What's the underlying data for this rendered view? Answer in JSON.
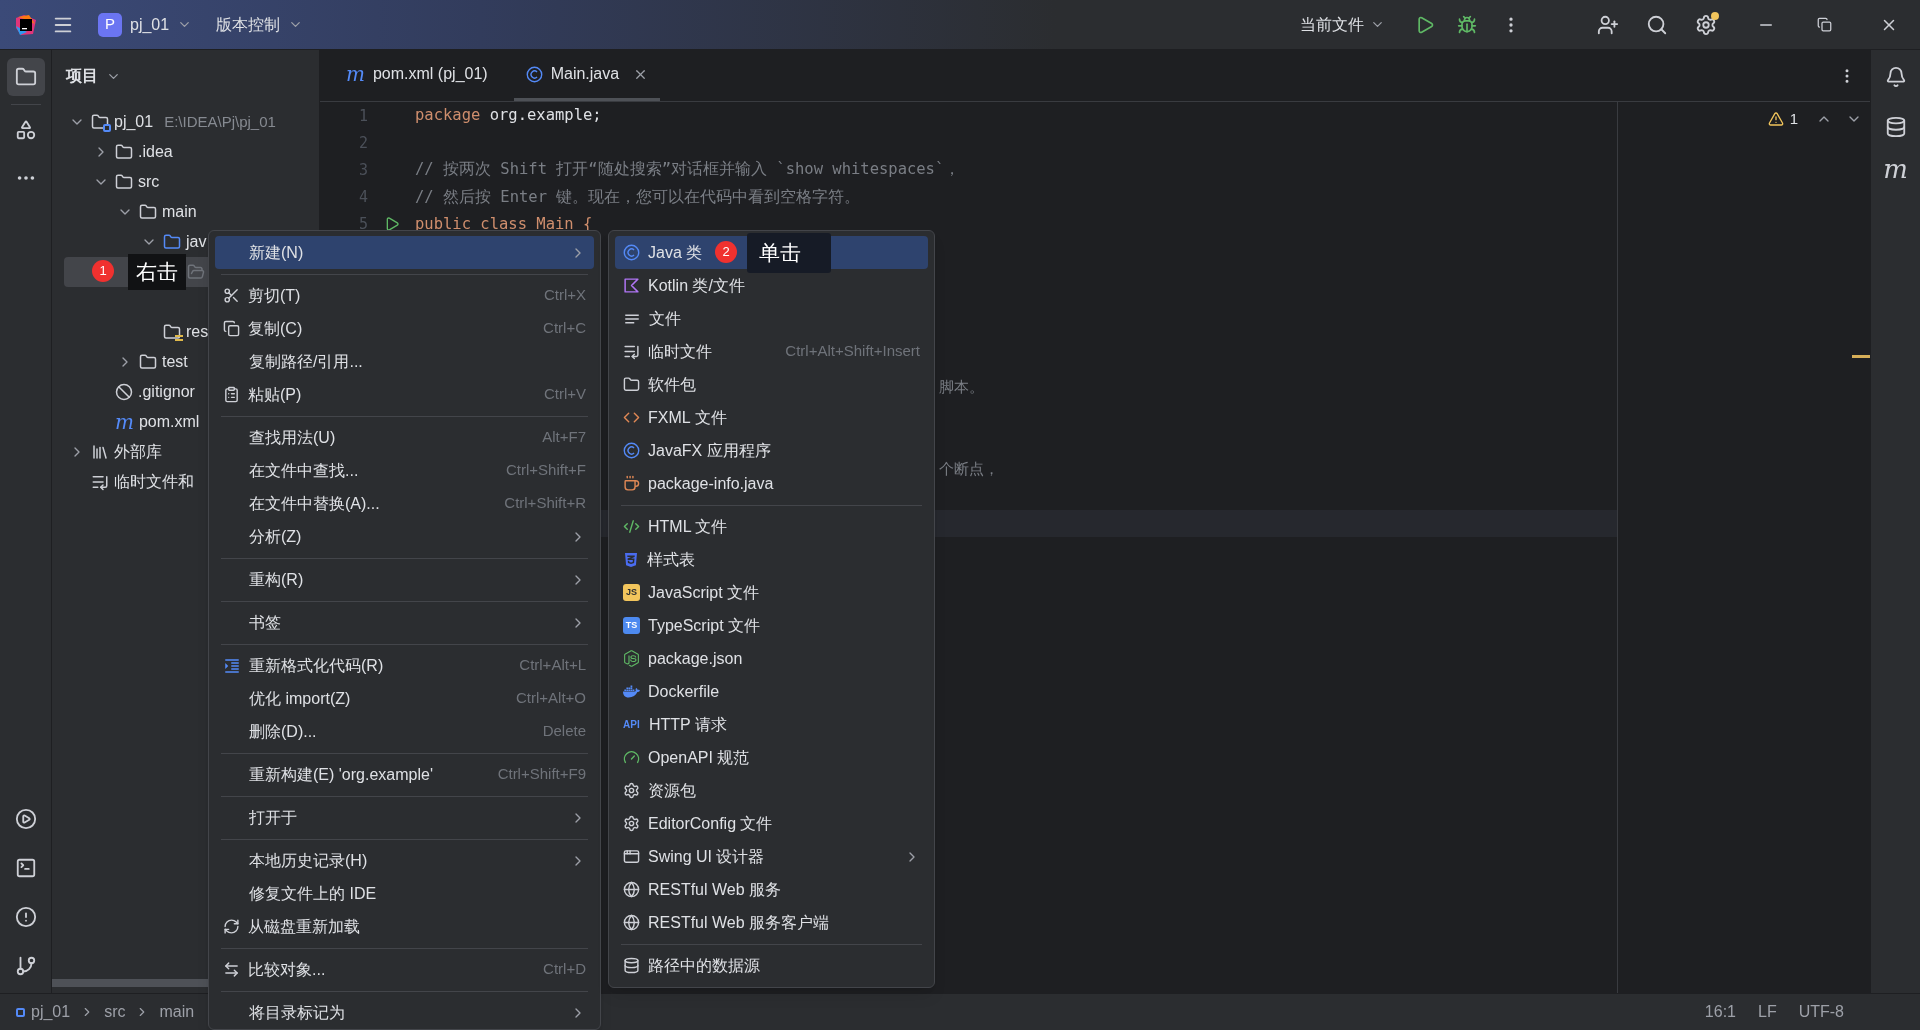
{
  "title_bar": {
    "project_badge": "P",
    "project": "pj_01",
    "vcs": "版本控制",
    "run_config": "当前文件"
  },
  "project_panel": {
    "title": "项目",
    "tree": [
      {
        "kind": "project",
        "label": "pj_01",
        "hint": "E:\\IDEA\\Pj\\pj_01",
        "expanded": true,
        "selected": false,
        "children": [
          {
            "kind": "folder",
            "label": ".idea",
            "expanded": false,
            "selected": false
          },
          {
            "kind": "folder",
            "label": "src",
            "expanded": true,
            "selected": false,
            "children": [
              {
                "kind": "folder",
                "label": "main",
                "expanded": true,
                "selected": false,
                "children": [
                  {
                    "kind": "source",
                    "label": "jav",
                    "expanded": true,
                    "selected": false,
                    "children": [
                      {
                        "kind": "package",
                        "selected": true
                      }
                    ]
                  },
                  {
                    "kind": "resources",
                    "label": "res",
                    "selected": false
                  }
                ]
              },
              {
                "kind": "folder",
                "label": "test",
                "expanded": false,
                "selected": false
              }
            ]
          },
          {
            "kind": "gitignore",
            "label": ".gitignor",
            "selected": false
          },
          {
            "kind": "maven",
            "icon_text": "m",
            "label": "pom.xml",
            "selected": false
          }
        ]
      },
      {
        "kind": "library",
        "label": "外部库",
        "expanded": false,
        "selected": false
      },
      {
        "kind": "scratch",
        "label": "临时文件和",
        "selected": false
      }
    ]
  },
  "tabs": [
    {
      "icon_text": "m",
      "label": "pom.xml (pj_01)",
      "selected": false,
      "closable": false
    },
    {
      "label": "Main.java",
      "selected": true,
      "closable": true
    }
  ],
  "editor": {
    "warnings": "1",
    "lines": [
      {
        "number": "1",
        "text": "package org.example;",
        "current": false
      },
      {
        "number": "2",
        "current": false
      },
      {
        "number": "3",
        "text": "// 按两次 Shift 打开“随处搜索”对话框并输入 `show whitespaces`，",
        "current": false
      },
      {
        "number": "4",
        "text": "// 然后按 Enter 键。现在，您可以在代码中看到空格字符。",
        "current": false
      },
      {
        "number": "5",
        "text": "public class Main {",
        "current": false
      },
      {
        "current": false
      },
      {
        "current": false
      },
      {
        "current": false
      },
      {
        "current": false
      },
      {
        "current": false
      },
      {
        "fragment": "脚本。",
        "current": false
      },
      {
        "current": false
      },
      {
        "current": false
      },
      {
        "fragment": "个断点，",
        "current": false
      },
      {
        "current": false
      },
      {
        "current": true
      }
    ]
  },
  "context_menu": [
    {
      "kind": "item",
      "label": "新建(N)",
      "submenu": true,
      "selected": true
    },
    {
      "kind": "separator"
    },
    {
      "kind": "item",
      "label": "剪切(T)",
      "shortcut": "Ctrl+X",
      "submenu": false,
      "selected": false
    },
    {
      "kind": "item",
      "label": "复制(C)",
      "shortcut": "Ctrl+C",
      "submenu": false,
      "selected": false
    },
    {
      "kind": "item",
      "label": "复制路径/引用...",
      "submenu": false,
      "selected": false
    },
    {
      "kind": "item",
      "label": "粘贴(P)",
      "shortcut": "Ctrl+V",
      "submenu": false,
      "selected": false
    },
    {
      "kind": "separator"
    },
    {
      "kind": "item",
      "label": "查找用法(U)",
      "shortcut": "Alt+F7",
      "submenu": false,
      "selected": false
    },
    {
      "kind": "item",
      "label": "在文件中查找...",
      "shortcut": "Ctrl+Shift+F",
      "submenu": false,
      "selected": false
    },
    {
      "kind": "item",
      "label": "在文件中替换(A)...",
      "shortcut": "Ctrl+Shift+R",
      "submenu": false,
      "selected": false
    },
    {
      "kind": "item",
      "label": "分析(Z)",
      "submenu": true,
      "selected": false
    },
    {
      "kind": "separator"
    },
    {
      "kind": "item",
      "label": "重构(R)",
      "submenu": true,
      "selected": false
    },
    {
      "kind": "separator"
    },
    {
      "kind": "item",
      "label": "书签",
      "submenu": true,
      "selected": false
    },
    {
      "kind": "separator"
    },
    {
      "kind": "item",
      "label": "重新格式化代码(R)",
      "shortcut": "Ctrl+Alt+L",
      "submenu": false,
      "selected": false
    },
    {
      "kind": "item",
      "label": "优化 import(Z)",
      "shortcut": "Ctrl+Alt+O",
      "submenu": false,
      "selected": false
    },
    {
      "kind": "item",
      "label": "删除(D)...",
      "shortcut": "Delete",
      "submenu": false,
      "selected": false
    },
    {
      "kind": "separator"
    },
    {
      "kind": "item",
      "label": "重新构建(E) 'org.example'",
      "shortcut": "Ctrl+Shift+F9",
      "submenu": false,
      "selected": false
    },
    {
      "kind": "separator"
    },
    {
      "kind": "item",
      "label": "打开于",
      "submenu": true,
      "selected": false
    },
    {
      "kind": "separator"
    },
    {
      "kind": "item",
      "label": "本地历史记录(H)",
      "submenu": true,
      "selected": false
    },
    {
      "kind": "item",
      "label": "修复文件上的 IDE",
      "submenu": false,
      "selected": false
    },
    {
      "kind": "item",
      "label": "从磁盘重新加载",
      "submenu": false,
      "selected": false
    },
    {
      "kind": "separator"
    },
    {
      "kind": "item",
      "label": "比较对象...",
      "shortcut": "Ctrl+D",
      "submenu": false,
      "selected": false
    },
    {
      "kind": "separator"
    },
    {
      "kind": "item",
      "label": "将目录标记为",
      "submenu": true,
      "selected": false
    }
  ],
  "new_submenu": [
    {
      "kind": "item",
      "label": "Java 类",
      "submenu": false,
      "selected": true
    },
    {
      "kind": "item",
      "label": "Kotlin 类/文件",
      "submenu": false,
      "selected": false
    },
    {
      "kind": "item",
      "label": "文件",
      "submenu": false,
      "selected": false
    },
    {
      "kind": "item",
      "label": "临时文件",
      "shortcut": "Ctrl+Alt+Shift+Insert",
      "submenu": false,
      "selected": false
    },
    {
      "kind": "item",
      "label": "软件包",
      "submenu": false,
      "selected": false
    },
    {
      "kind": "item",
      "label": "FXML 文件",
      "submenu": false,
      "selected": false
    },
    {
      "kind": "item",
      "label": "JavaFX 应用程序",
      "submenu": false,
      "selected": false
    },
    {
      "kind": "item",
      "label": "package-info.java",
      "submenu": false,
      "selected": false
    },
    {
      "kind": "separator"
    },
    {
      "kind": "item",
      "label": "HTML 文件",
      "submenu": false,
      "selected": false
    },
    {
      "kind": "item",
      "label": "样式表",
      "submenu": false,
      "selected": false
    },
    {
      "kind": "item",
      "icon_text": "JS",
      "label": "JavaScript 文件",
      "submenu": false,
      "selected": false
    },
    {
      "kind": "item",
      "icon_text": "TS",
      "label": "TypeScript 文件",
      "submenu": false,
      "selected": false
    },
    {
      "kind": "item",
      "label": "package.json",
      "submenu": false,
      "selected": false
    },
    {
      "kind": "item",
      "label": "Dockerfile",
      "submenu": false,
      "selected": false
    },
    {
      "kind": "item",
      "icon_text": "API",
      "label": "HTTP 请求",
      "submenu": false,
      "selected": false
    },
    {
      "kind": "item",
      "label": "OpenAPI 规范",
      "submenu": false,
      "selected": false
    },
    {
      "kind": "item",
      "label": "资源包",
      "submenu": false,
      "selected": false
    },
    {
      "kind": "item",
      "label": "EditorConfig 文件",
      "submenu": false,
      "selected": false
    },
    {
      "kind": "item",
      "label": "Swing UI 设计器",
      "submenu": true,
      "selected": false
    },
    {
      "kind": "item",
      "label": "RESTful Web 服务",
      "submenu": false,
      "selected": false
    },
    {
      "kind": "item",
      "label": "RESTful Web 服务客户端",
      "submenu": false,
      "selected": false
    },
    {
      "kind": "separator"
    },
    {
      "kind": "item",
      "label": "路径中的数据源",
      "submenu": false,
      "selected": false
    }
  ],
  "annotations": [
    {
      "number": "1",
      "text": "右击"
    },
    {
      "number": "2",
      "text": "单击"
    }
  ],
  "right_strip": {
    "icon_text": "m"
  },
  "status_bar": {
    "breadcrumbs": [
      "pj_01",
      "src",
      "main"
    ],
    "items": [
      "16:1",
      "LF",
      "UTF-8"
    ]
  }
}
